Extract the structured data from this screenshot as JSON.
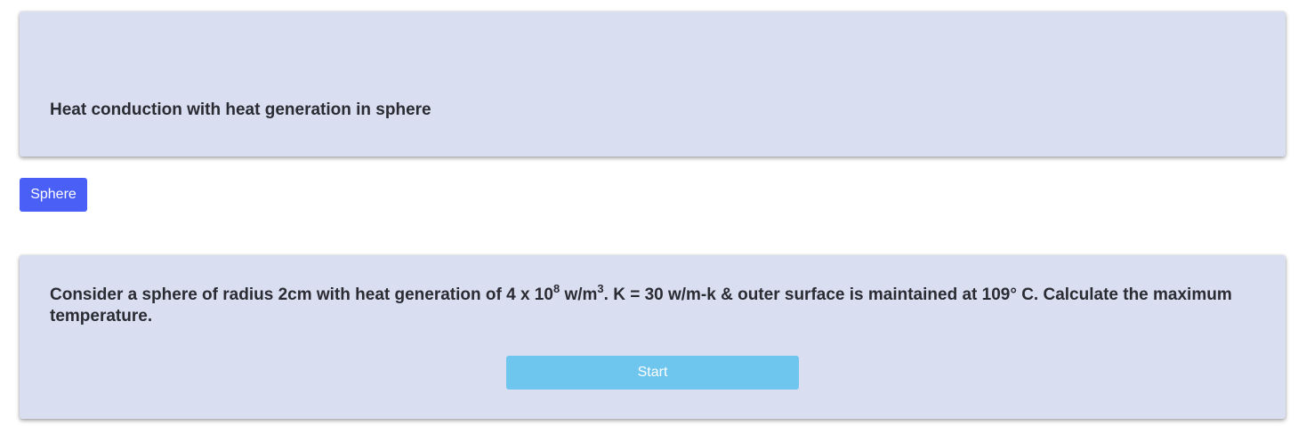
{
  "header": {
    "title": "Heat conduction with heat generation in sphere"
  },
  "tag": {
    "label": "Sphere",
    "color": "#4a5ff5"
  },
  "question": {
    "part1": "Consider a sphere of radius 2cm with heat generation of 4 x 10",
    "exp1": "8",
    "part2": " w/m",
    "exp2": "3",
    "part3": ". K = 30 w/m-k & outer surface is maintained at 109° C. Calculate the maximum temperature.",
    "start_label": "Start",
    "start_color": "#6ec5ee"
  },
  "colors": {
    "card_background": "#d9def0"
  }
}
